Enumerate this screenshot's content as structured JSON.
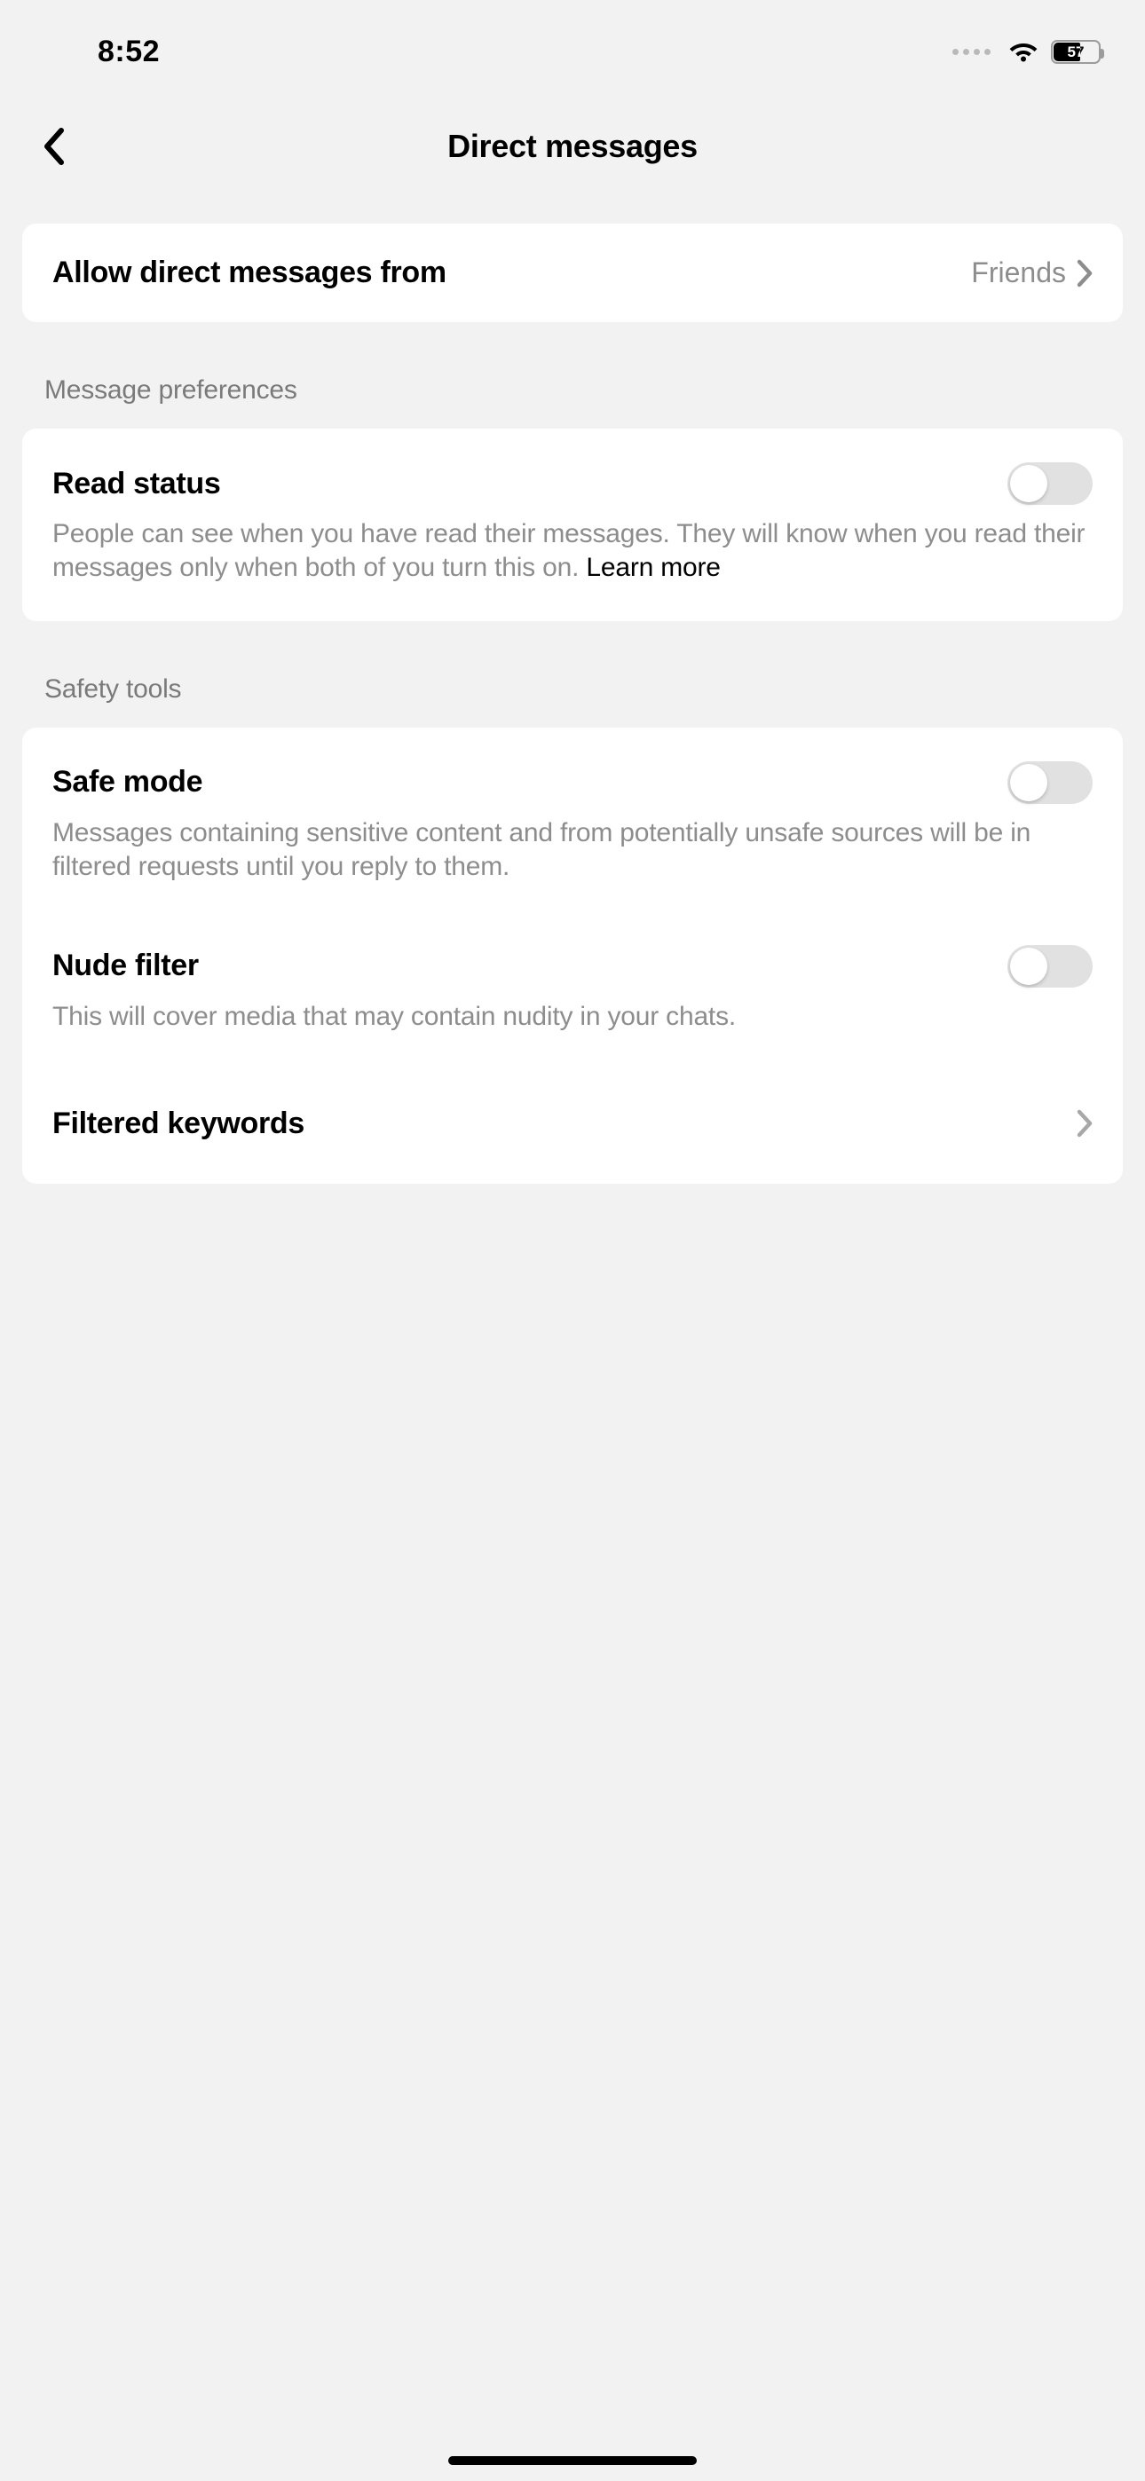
{
  "status_bar": {
    "time": "8:52",
    "battery_percent": "57"
  },
  "header": {
    "title": "Direct messages"
  },
  "allow_from": {
    "label": "Allow direct messages from",
    "value": "Friends"
  },
  "sections": {
    "prefs_header": "Message preferences",
    "safety_header": "Safety tools"
  },
  "read_status": {
    "title": "Read status",
    "desc_part1": "People can see when you have read their messages. They will know when you read their messages only when both of you turn this on. ",
    "learn_more": "Learn more"
  },
  "safe_mode": {
    "title": "Safe mode",
    "desc": "Messages containing sensitive content and from potentially unsafe sources will be in filtered requests until you reply to them."
  },
  "nude_filter": {
    "title": "Nude filter",
    "desc": "This will cover media that may contain nudity in your chats."
  },
  "filtered_keywords": {
    "title": "Filtered keywords"
  }
}
